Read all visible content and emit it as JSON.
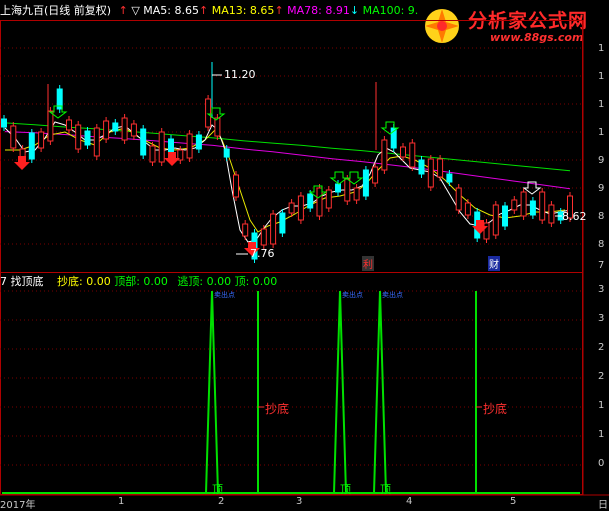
{
  "header": {
    "title": "上海九百(日线 前复权)",
    "indicator_prefix": "▽",
    "ma5_label": "MA5: 8.65",
    "ma13_label": "MA13: 8.65",
    "ma78_label": "MA78: 8.91",
    "ma100_label": "MA100: 9.",
    "colors": {
      "ma5": "#ffffff",
      "ma13": "#ffff00",
      "ma78": "#ff00ff",
      "ma100": "#00ff00",
      "up": "#ff3030",
      "down": "#00ffff"
    }
  },
  "logo": {
    "main": "分析家公式网",
    "url": "www.88gs.com"
  },
  "price_chart": {
    "high_label": "11.20",
    "low_label": "7.76",
    "last_label": "8.62",
    "marker_1": "利",
    "marker_2": "财"
  },
  "indicator_panel": {
    "name": "找顶底",
    "prefix": "7",
    "chaodi_label": "抄底: 0.00",
    "dingbu_label": "顶部: 0.00",
    "taoding_label": "逃顶: 0.00",
    "ding_label": "顶: 0.00",
    "annotation_buy": "抄底",
    "annotation_ding": "顶",
    "annotation_tiny": "卖出点"
  },
  "right_axis": {
    "top_ticks": [
      "1",
      "1",
      "1",
      "1",
      "9",
      "9",
      "8",
      "8",
      "7"
    ],
    "bottom_ticks": [
      "3",
      "3",
      "2",
      "2",
      "1",
      "1",
      "0"
    ]
  },
  "date_axis": {
    "labels": [
      "2017年",
      "1",
      "2",
      "3",
      "4",
      "5",
      "日"
    ]
  },
  "chart_data": {
    "type": "line",
    "title": "",
    "series": [
      {
        "name": "MA100",
        "values": [
          10.05,
          10.02,
          9.98,
          9.95,
          9.91,
          9.87,
          9.83,
          9.79,
          9.74,
          9.7,
          9.66,
          9.61,
          9.57,
          9.52,
          9.47,
          9.42,
          9.37,
          9.32,
          9.27,
          9.22
        ]
      },
      {
        "name": "MA78",
        "values": [
          9.9,
          9.88,
          9.85,
          9.81,
          9.78,
          9.74,
          9.7,
          9.66,
          9.6,
          9.55,
          9.49,
          9.43,
          9.38,
          9.32,
          9.26,
          9.19,
          9.12,
          9.05,
          8.98,
          8.91
        ]
      }
    ],
    "ylim": [
      7.5,
      11.8
    ],
    "indicator": {
      "ylim": [
        0,
        3.4
      ],
      "spikes": [
        {
          "label": "顶",
          "value": 3.0
        },
        {
          "label": "抄底",
          "value": 3.0
        },
        {
          "label": "顶",
          "value": 3.0
        },
        {
          "label": "顶",
          "value": 3.0
        },
        {
          "label": "抄底",
          "value": 3.0
        }
      ]
    }
  }
}
